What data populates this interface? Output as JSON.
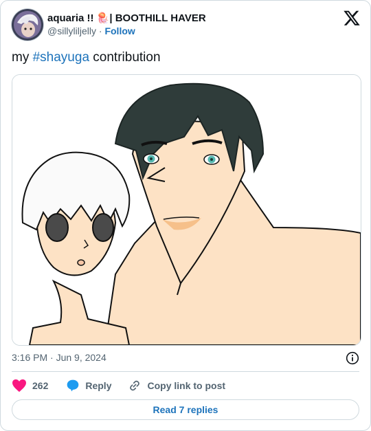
{
  "tweet": {
    "display_name": "aquaria !! 🪼| BOOTHILL HAVER",
    "handle": "@sillyliljelly",
    "separator": "·",
    "follow_label": "Follow",
    "text_before": "my ",
    "hashtag": "#shayuga",
    "text_after": " contribution",
    "time": "3:16 PM · Jun 9, 2024"
  },
  "actions": {
    "like_count": "262",
    "reply_label": "Reply",
    "copy_link_label": "Copy link to post"
  },
  "footer": {
    "read_replies_label": "Read 7 replies"
  },
  "icons": {
    "logo": "x-logo-icon",
    "info": "info-icon",
    "heart": "heart-icon",
    "reply": "reply-bubble-icon",
    "link": "link-icon"
  },
  "colors": {
    "link": "#1d73bb",
    "heart": "#f91880",
    "reply": "#1d9bf0",
    "muted": "#536471",
    "border": "#cfd9de"
  }
}
